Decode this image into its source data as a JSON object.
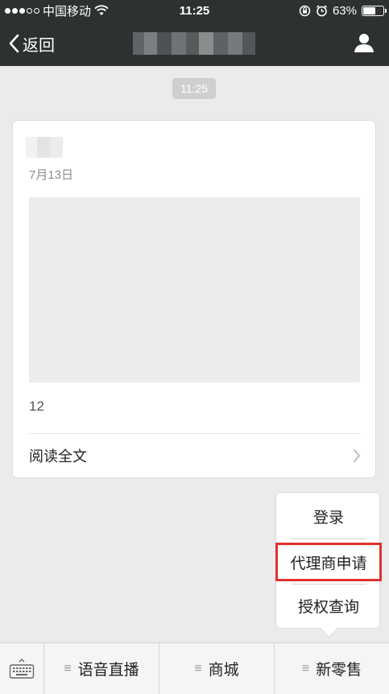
{
  "status_bar": {
    "carrier": "中国移动",
    "time": "11:25",
    "battery_percent": "63%",
    "battery_level": 0.63
  },
  "nav": {
    "back_label": "返回"
  },
  "chat": {
    "timestamp": "11:25"
  },
  "article": {
    "date": "7月13日",
    "text": "12",
    "read_more_label": "阅读全文"
  },
  "popup_menu": {
    "items": [
      {
        "label": "登录"
      },
      {
        "label": "代理商申请"
      },
      {
        "label": "授权查询"
      }
    ]
  },
  "bottom_menu": {
    "menu_icon": "≡",
    "tabs": [
      {
        "label": "语音直播"
      },
      {
        "label": "商城"
      },
      {
        "label": "新零售"
      }
    ]
  }
}
